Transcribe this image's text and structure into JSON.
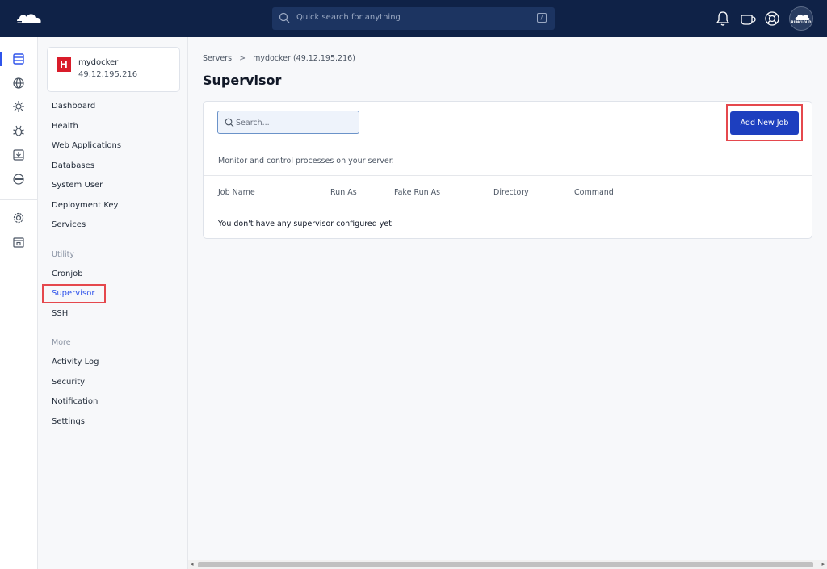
{
  "topbar": {
    "search_placeholder": "Quick search for anything",
    "shortcut_key": "/",
    "avatar_label": "RUNCLOUD"
  },
  "server": {
    "badge": "H",
    "name": "mydocker",
    "ip": "49.12.195.216"
  },
  "nav": {
    "items": [
      "Dashboard",
      "Health",
      "Web Applications",
      "Databases",
      "System User",
      "Deployment Key",
      "Services"
    ],
    "utility_label": "Utility",
    "utility_items": [
      "Cronjob",
      "Supervisor",
      "SSH"
    ],
    "more_label": "More",
    "more_items": [
      "Activity Log",
      "Security",
      "Notification",
      "Settings"
    ],
    "active": "Supervisor"
  },
  "breadcrumb": {
    "root": "Servers",
    "separator": ">",
    "current": "mydocker (49.12.195.216)"
  },
  "page": {
    "title": "Supervisor",
    "search_placeholder": "Search...",
    "add_button": "Add New Job",
    "description": "Monitor and control processes on your server.",
    "columns": [
      "Job Name",
      "Run As",
      "Fake Run As",
      "Directory",
      "Command"
    ],
    "empty_message": "You don't have any supervisor configured yet."
  },
  "colors": {
    "topbar": "#0f2247",
    "accent": "#2f54eb",
    "button": "#1d3fbf",
    "highlight": "#e5484d"
  }
}
